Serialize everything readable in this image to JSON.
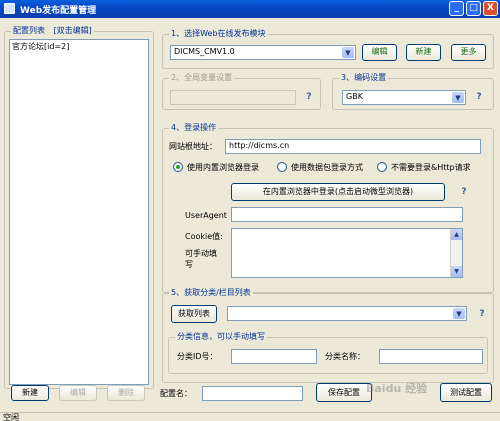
{
  "window": {
    "title": "Web发布配置管理",
    "minimize": "_",
    "maximize": "□",
    "close": "X"
  },
  "left_panel": {
    "title": "配置列表",
    "hint": "[双击编辑]",
    "items": [
      "官方论坛[id=2]"
    ],
    "buttons": {
      "new": "新建",
      "edit": "编辑",
      "delete": "删除"
    }
  },
  "section1": {
    "title": "1、选择Web在线发布模块",
    "module_value": "DICMS_CMV1.0",
    "edit": "编辑",
    "new": "新建",
    "more": "更多"
  },
  "section2": {
    "title": "2、全局变量设置",
    "help": "?"
  },
  "section3": {
    "title": "3、编码设置",
    "encoding": "GBK",
    "help": "?"
  },
  "section4": {
    "title": "4、登录操作",
    "root_label": "网站根地址：",
    "root_value": "http://dicms.cn",
    "options": [
      "使用内置浏览器登录",
      "使用数据包登录方式",
      "不需要登录&Http请求"
    ],
    "login_button": "在内置浏览器中登录(点击启动微型浏览器)",
    "useragent_label": "UserAgent",
    "cookie_label": "Cookie值:",
    "editable_label_1": "可手动填",
    "editable_label_2": "写",
    "help": "?"
  },
  "section5": {
    "title": "5、获取分类/栏目列表",
    "get_list": "获取列表",
    "sub_title": "分类信息，可以手动填写",
    "cat_id_label": "分类ID号：",
    "cat_name_label": "分类名称：",
    "help": "?"
  },
  "bottom": {
    "config_name_label": "配置名：",
    "save": "保存配置",
    "test": "测试配置",
    "status": "空闲"
  },
  "watermark": "Baidu 经验"
}
